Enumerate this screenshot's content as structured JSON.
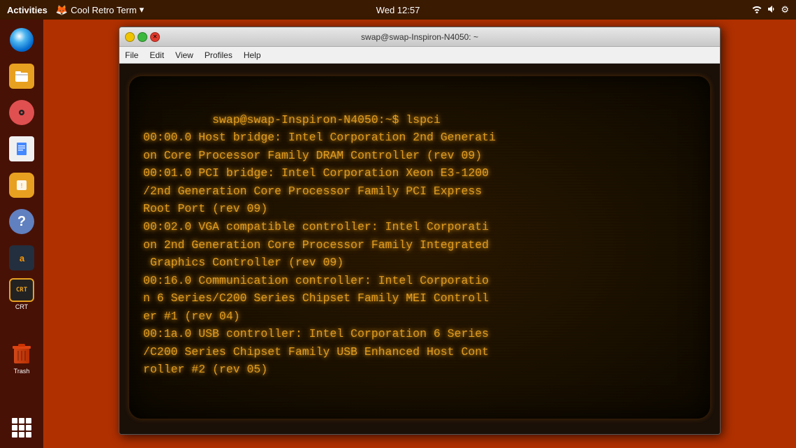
{
  "topbar": {
    "activities_label": "Activities",
    "app_name": "Cool Retro Term",
    "time": "Wed 12:57",
    "title_arrow": "▾"
  },
  "terminal": {
    "title": "swap@swap-Inspiron-N4050: ~",
    "menu": [
      "File",
      "Edit",
      "View",
      "Profiles",
      "Help"
    ],
    "crt_content": "swap@swap-Inspiron-N4050:~$ lspci\n00:00.0 Host bridge: Intel Corporation 2nd Generati\non Core Processor Family DRAM Controller (rev 09)\n00:01.0 PCI bridge: Intel Corporation Xeon E3-1200\n/2nd Generation Core Processor Family PCI Express\nRoot Port (rev 09)\n00:02.0 VGA compatible controller: Intel Corporati\non 2nd Generation Core Processor Family Integrated\n Graphics Controller (rev 09)\n00:16.0 Communication controller: Intel Corporatio\nn 6 Series/C200 Series Chipset Family MEI Controll\ner #1 (rev 04)\n00:1a.0 USB controller: Intel Corporation 6 Series\n/C200 Series Chipset Family USB Enhanced Host Cont\nroller #2 (rev 05)"
  },
  "dock": {
    "items": [
      {
        "name": "trash",
        "label": "Trash"
      },
      {
        "name": "firefox",
        "label": ""
      },
      {
        "name": "files",
        "label": ""
      },
      {
        "name": "music",
        "label": ""
      },
      {
        "name": "docs",
        "label": ""
      },
      {
        "name": "software",
        "label": ""
      },
      {
        "name": "help",
        "label": ""
      },
      {
        "name": "amazon",
        "label": ""
      },
      {
        "name": "crt",
        "label": "CRT"
      }
    ]
  },
  "colors": {
    "crt_text": "#e8a020",
    "topbar_bg": "#3a1a00",
    "sidebar_bg": "rgba(50,10,0,0.85)",
    "desktop_bg": "#b03000"
  }
}
